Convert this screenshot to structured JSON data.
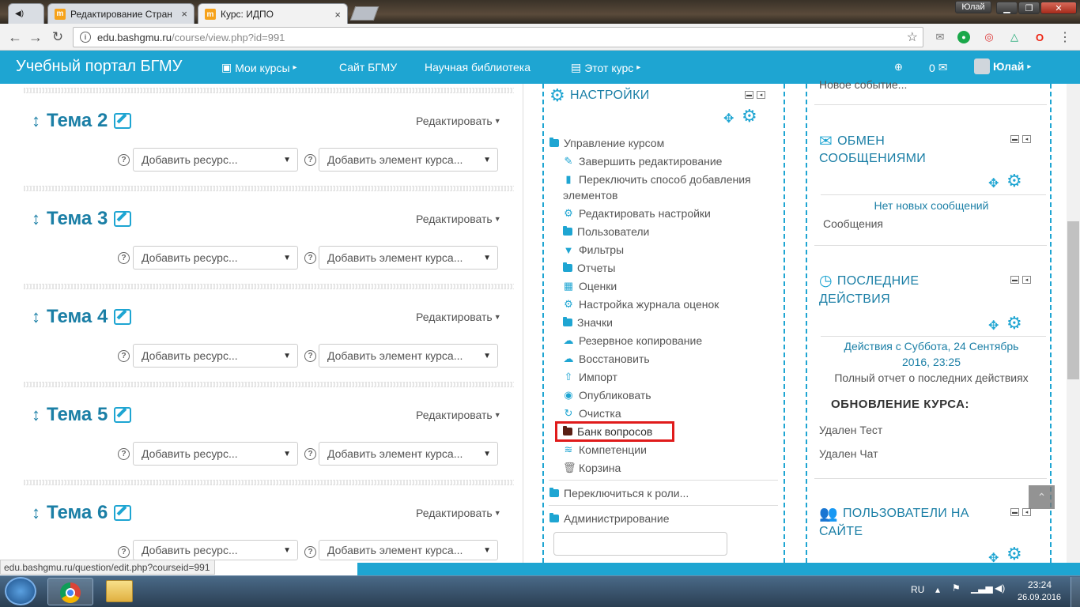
{
  "browser": {
    "tabs": [
      {
        "label": "Редактирование Стран",
        "favicon": "m"
      },
      {
        "label": "Курс: ИДПО",
        "favicon": "m"
      }
    ],
    "window_user": "Юлай",
    "url_host": "edu.bashgmu.ru",
    "url_path": "/course/view.php?id=991",
    "status_url": "edu.bashgmu.ru/question/edit.php?courseid=991"
  },
  "navbar": {
    "brand": "Учебный портал БГМУ",
    "my_courses": "Мои курсы",
    "site": "Сайт БГМУ",
    "library": "Научная библиотека",
    "this_course": "Этот курс",
    "messages_count": "0",
    "user": "Юлай"
  },
  "topics": [
    {
      "title": "Тема 2",
      "edit": "Редактировать",
      "add_resource": "Добавить ресурс...",
      "add_activity": "Добавить элемент курса..."
    },
    {
      "title": "Тема 3",
      "edit": "Редактировать",
      "add_resource": "Добавить ресурс...",
      "add_activity": "Добавить элемент курса..."
    },
    {
      "title": "Тема 4",
      "edit": "Редактировать",
      "add_resource": "Добавить ресурс...",
      "add_activity": "Добавить элемент курса..."
    },
    {
      "title": "Тема 5",
      "edit": "Редактировать",
      "add_resource": "Добавить ресурс...",
      "add_activity": "Добавить элемент курса..."
    },
    {
      "title": "Тема 6",
      "edit": "Редактировать",
      "add_resource": "Добавить ресурс...",
      "add_activity": "Добавить элемент курса..."
    }
  ],
  "settings": {
    "title": "НАСТРОЙКИ",
    "course_admin": "Управление курсом",
    "items": [
      {
        "label": "Завершить редактирование",
        "icon": "pencil-icon"
      },
      {
        "label": "Переключить способ добавления",
        "icon": "file-icon"
      },
      {
        "label": "элементов",
        "icon": ""
      },
      {
        "label": "Редактировать настройки",
        "icon": "cogs-icon"
      },
      {
        "label": "Пользователи",
        "icon": "folder-icon"
      },
      {
        "label": "Фильтры",
        "icon": "filter-icon"
      },
      {
        "label": "Отчеты",
        "icon": "folder-icon"
      },
      {
        "label": "Оценки",
        "icon": "table-icon"
      },
      {
        "label": "Настройка журнала оценок",
        "icon": "cogs-icon"
      },
      {
        "label": "Значки",
        "icon": "folder-icon"
      },
      {
        "label": "Резервное копирование",
        "icon": "cloud-upload-icon"
      },
      {
        "label": "Восстановить",
        "icon": "cloud-download-icon"
      },
      {
        "label": "Импорт",
        "icon": "upload-icon"
      },
      {
        "label": "Опубликовать",
        "icon": "globe-icon"
      },
      {
        "label": "Очистка",
        "icon": "refresh-icon"
      },
      {
        "label": "Банк вопросов",
        "icon": "folder-icon"
      },
      {
        "label": "Компетенции",
        "icon": "stack-icon"
      },
      {
        "label": "Корзина",
        "icon": "trash-icon"
      }
    ],
    "switch_role": "Переключиться к роли...",
    "administration": "Администрирование"
  },
  "right": {
    "new_event": "Новое событие...",
    "messages_title_1": "ОБМЕН",
    "messages_title_2": "СООБЩЕНИЯМИ",
    "no_messages": "Нет новых сообщений",
    "messages_link": "Сообщения",
    "recent_title_1": "ПОСЛЕДНИЕ",
    "recent_title_2": "ДЕЙСТВИЯ",
    "recent_since_1": "Действия с Суббота, 24 Сентябрь",
    "recent_since_2": "2016, 23:25",
    "full_report": "Полный отчет о последних действиях",
    "updates_title": "ОБНОВЛЕНИЕ КУРСА:",
    "updates": [
      "Удален Тест",
      "Удален Чат"
    ],
    "online_title_1": "ПОЛЬЗОВАТЕЛИ НА",
    "online_title_2": "САЙТЕ"
  },
  "taskbar": {
    "lang": "RU",
    "time": "23:24",
    "date": "26.09.2016"
  },
  "colors": {
    "accent": "#1ea5d2",
    "highlight": "#e01b1b"
  }
}
